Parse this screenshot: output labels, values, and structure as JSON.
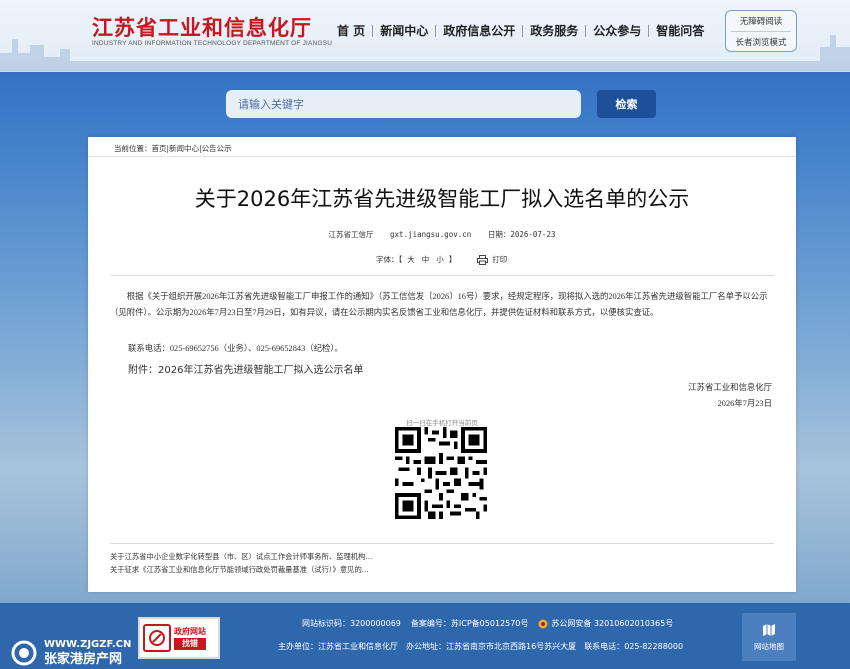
{
  "header": {
    "logo_cn": "江苏省工业和信息化厅",
    "logo_en": "INDUSTRY AND INFORMATION TECHNOLOGY DEPARTMENT OF JIANGSU",
    "nav": [
      "首 页",
      "新闻中心",
      "政府信息公开",
      "政务服务",
      "公众参与",
      "智能问答"
    ],
    "accessibility": "无障碍阅读",
    "elder_mode": "长者浏览模式"
  },
  "search": {
    "placeholder": "请输入关键字",
    "button": "检索"
  },
  "breadcrumb": {
    "prefix": "当前位置：",
    "items": [
      "首页",
      "新闻中心",
      "公告公示"
    ],
    "sep": "|"
  },
  "article": {
    "title": "关于2026年江苏省先进级智能工厂拟入选名单的公示",
    "source": "江苏省工信厅",
    "site": "gxt.jiangsu.gov.cn",
    "date_label": "日期：",
    "date": "2026-07-23",
    "font_label": "字体：【",
    "font_big": "大",
    "font_mid": "中",
    "font_small": "小",
    "font_close": "】",
    "print_label": "打印",
    "paragraph": "根据《关于组织开展2026年江苏省先进级智能工厂申报工作的通知》（苏工信信发〔2026〕16号）要求，经规定程序，现将拟入选的2026年江苏省先进级智能工厂名单予以公示（见附件）。公示期为2026年7月23日至7月29日，如有异议，请在公示期内实名反馈省工业和信息化厅，并提供佐证材料和联系方式，以便核实查证。",
    "contact": "联系电话：025-69652756（业务）、025-69652843（纪检）。",
    "attach_prefix": "附件：",
    "attach_link": "2026年江苏省先进级智能工厂拟入选公示名单",
    "sign_org": "江苏省工业和信息化厅",
    "sign_date": "2026年7月23日",
    "qr_label": "扫一扫在手机打开当前页"
  },
  "related": [
    "关于江苏省中小企业数字化转型县（市、区）试点工作会计师事务所、监理机构...",
    "关于征求《江苏省工业和信息化厅节能领域行政处罚裁量基准（试行）》意见的..."
  ],
  "footer": {
    "watermark_url": "WWW.ZJGZF.CN",
    "watermark_name": "张家港房产网",
    "gov_badge_line1": "政府网站",
    "gov_badge_line2": "找错",
    "site_id_label": "网站标识码：",
    "site_id": "3200000069",
    "icp_label": "备案编号：",
    "icp": "苏ICP备05012570号",
    "police": "苏公网安备 32010602010365号",
    "host_label": "主办单位：",
    "host": "江苏省工业和信息化厅",
    "addr_label": "办公地址：",
    "addr": "江苏省南京市北京西路16号苏兴大厦",
    "tel_label": "联系电话：",
    "tel": "025-82288000",
    "sitemap": "网站地图"
  },
  "colors": {
    "brand_red": "#c8161d",
    "primary_blue": "#1d4f9a",
    "footer_blue": "#2f67ad"
  }
}
